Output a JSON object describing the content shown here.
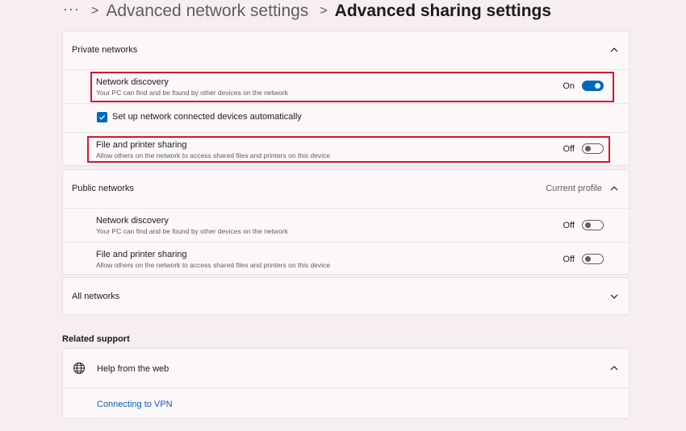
{
  "breadcrumb": {
    "more": "···",
    "separator": ">",
    "parent": "Advanced network settings",
    "current": "Advanced sharing settings"
  },
  "private_networks": {
    "title": "Private networks",
    "network_discovery": {
      "title": "Network discovery",
      "description": "Your PC can find and be found by other devices on the network",
      "state": "On"
    },
    "auto_setup": {
      "label": "Set up network connected devices automatically",
      "checked": true
    },
    "file_printer_sharing": {
      "title": "File and printer sharing",
      "description": "Allow others on the network to access shared files and printers on this device",
      "state": "Off"
    }
  },
  "public_networks": {
    "title": "Public networks",
    "badge": "Current profile",
    "network_discovery": {
      "title": "Network discovery",
      "description": "Your PC can find and be found by other devices on the network",
      "state": "Off"
    },
    "file_printer_sharing": {
      "title": "File and printer sharing",
      "description": "Allow others on the network to access shared files and printers on this device",
      "state": "Off"
    }
  },
  "all_networks": {
    "title": "All networks"
  },
  "related_support": {
    "heading": "Related support",
    "help_title": "Help from the web",
    "link": "Connecting to VPN"
  },
  "colors": {
    "accent": "#0067c0",
    "highlight": "#d3182a",
    "background": "#f7eef3"
  },
  "icons": [
    "more-icon",
    "chevron-right-icon",
    "chevron-up-icon",
    "chevron-down-icon",
    "checkmark-icon",
    "globe-icon"
  ]
}
